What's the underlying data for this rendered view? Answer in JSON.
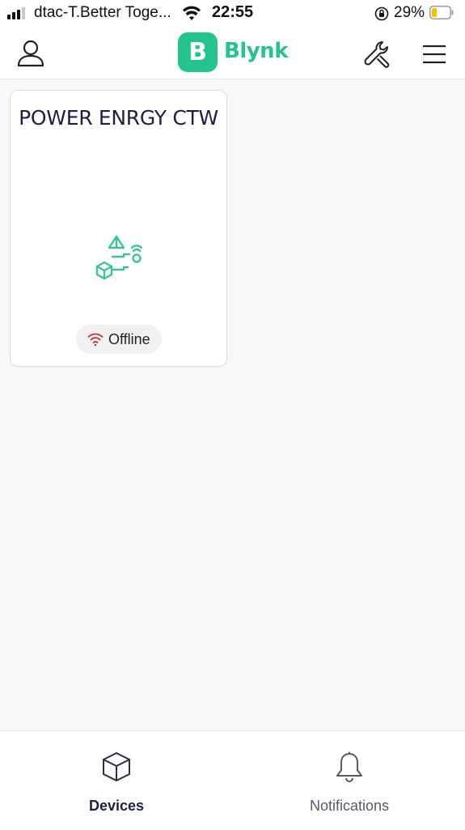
{
  "status_bar": {
    "carrier": "dtac-T.Better Toge...",
    "time": "22:55",
    "battery_percent": "29%",
    "battery_level": 0.29,
    "signal_bars": 3,
    "icons": [
      "signal-icon",
      "wifi-icon",
      "orientation-lock-icon",
      "battery-icon"
    ]
  },
  "header": {
    "logo_letter": "B",
    "logo_text": "Blynk",
    "icons": [
      "profile-icon",
      "wrench-icon",
      "hamburger-menu-icon"
    ]
  },
  "devices": [
    {
      "name": "POWER ENRGY CTW",
      "status": "Offline",
      "icon": "device-template-icon",
      "status_icon": "wifi-offline-icon"
    }
  ],
  "tabs": [
    {
      "label": "Devices",
      "icon": "cube-icon",
      "active": true
    },
    {
      "label": "Notifications",
      "icon": "bell-icon",
      "active": false
    }
  ],
  "colors": {
    "brand": "#23c48e",
    "offline": "#c2324a",
    "title_text": "#1d2045",
    "background": "#f8f8f8"
  }
}
